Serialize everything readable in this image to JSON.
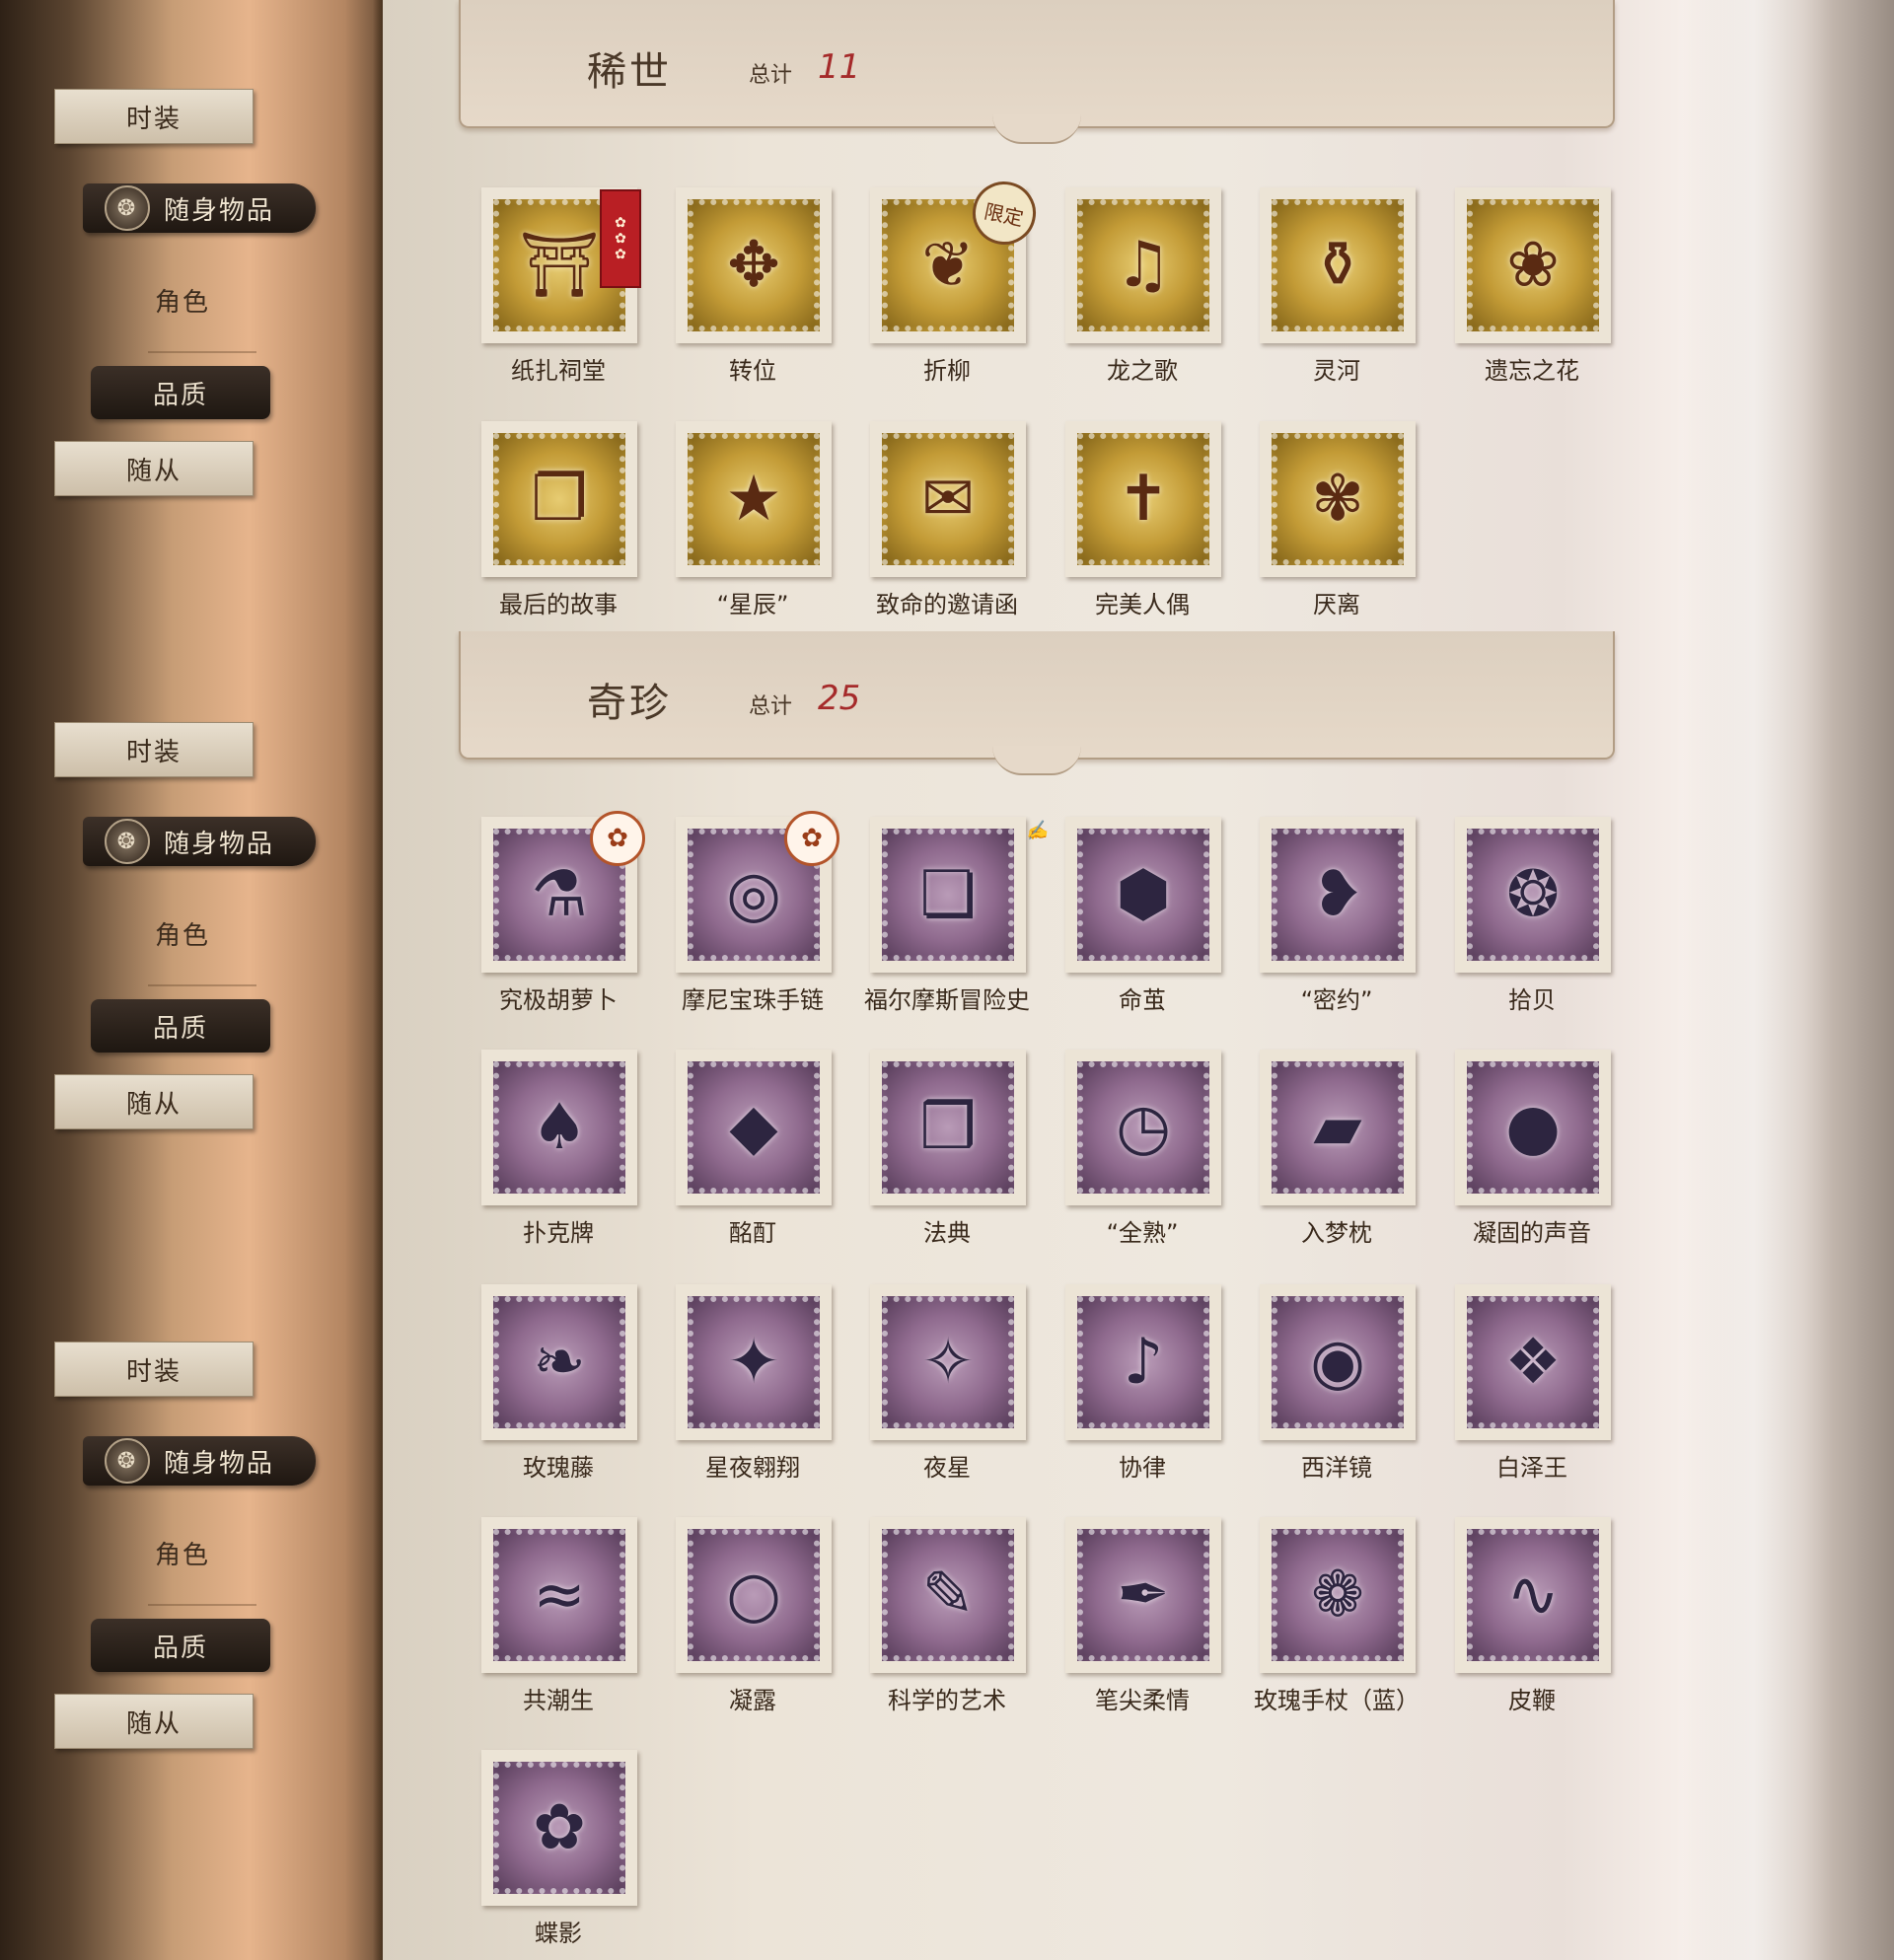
{
  "nav": {
    "fashion": "时装",
    "accessories": "随身物品",
    "role": "角色",
    "quality": "品质",
    "follower": "随从"
  },
  "sections": {
    "rare": {
      "title": "稀世",
      "total_label": "总计",
      "total": "11"
    },
    "precious": {
      "title": "奇珍",
      "total_label": "总计",
      "total": "25"
    }
  },
  "items": {
    "zhizha_citang": {
      "name": "纸扎祠堂",
      "icon": "paper-shrine-icon",
      "tier": "gold"
    },
    "zhuanwei": {
      "name": "转位",
      "icon": "transposition-icon",
      "tier": "gold"
    },
    "zheliu": {
      "name": "折柳",
      "icon": "willow-icon",
      "tier": "gold",
      "badge": "限定"
    },
    "longzhige": {
      "name": "龙之歌",
      "icon": "dragon-harp-icon",
      "tier": "gold"
    },
    "linghe": {
      "name": "灵河",
      "icon": "spirit-river-icon",
      "tier": "gold"
    },
    "yiwangzhihua": {
      "name": "遗忘之花",
      "icon": "forgotten-flower-icon",
      "tier": "gold"
    },
    "zuihoudegushi": {
      "name": "最后的故事",
      "icon": "last-story-book-icon",
      "tier": "gold"
    },
    "xingchen": {
      "name": "“星辰”",
      "icon": "star-bottle-icon",
      "tier": "gold"
    },
    "zhimingdeyaoqinghan": {
      "name": "致命的邀请函",
      "icon": "winged-letter-icon",
      "tier": "gold"
    },
    "wanmeirenou": {
      "name": "完美人偶",
      "icon": "ballerina-doll-icon",
      "tier": "gold"
    },
    "yanli": {
      "name": "厌离",
      "icon": "blossom-branch-icon",
      "tier": "gold"
    },
    "jiujihuluobo": {
      "name": "究极胡萝卜",
      "icon": "carrot-jar-icon",
      "tier": "purple"
    },
    "monibaozhushoulian": {
      "name": "摩尼宝珠手链",
      "icon": "bead-bracelet-icon",
      "tier": "purple"
    },
    "fuermosimaoxianshi": {
      "name": "福尔摩斯冒险史",
      "icon": "green-book-icon",
      "tier": "purple"
    },
    "mingjian": {
      "name": "命茧",
      "icon": "cocoon-icon",
      "tier": "purple"
    },
    "miyue": {
      "name": "“密约”",
      "icon": "necklace-icon",
      "tier": "purple"
    },
    "shibei": {
      "name": "拾贝",
      "icon": "seashell-icon",
      "tier": "purple"
    },
    "pukepai": {
      "name": "扑克牌",
      "icon": "poker-cards-icon",
      "tier": "purple"
    },
    "mingding": {
      "name": "酩酊",
      "icon": "blue-crystal-icon",
      "tier": "purple"
    },
    "fadian": {
      "name": "法典",
      "icon": "codex-icon",
      "tier": "purple"
    },
    "quanshu": {
      "name": "“全熟”",
      "icon": "pocket-watch-icon",
      "tier": "purple"
    },
    "rumengzhen": {
      "name": "入梦枕",
      "icon": "dream-pillow-icon",
      "tier": "purple"
    },
    "ningudeshengyin": {
      "name": "凝固的声音",
      "icon": "orb-icon",
      "tier": "purple"
    },
    "meiguiteng": {
      "name": "玫瑰藤",
      "icon": "rose-vine-icon",
      "tier": "purple"
    },
    "xingyeaoxiang": {
      "name": "星夜翱翔",
      "icon": "crystal-bird-icon",
      "tier": "purple"
    },
    "yexing": {
      "name": "夜星",
      "icon": "night-star-icon",
      "tier": "purple"
    },
    "xielv": {
      "name": "协律",
      "icon": "music-box-icon",
      "tier": "purple"
    },
    "xiyangjing": {
      "name": "西洋镜",
      "icon": "zoetrope-icon",
      "tier": "purple"
    },
    "baizewang": {
      "name": "白泽王",
      "icon": "white-deer-icon",
      "tier": "purple"
    },
    "gongchaosheng": {
      "name": "共潮生",
      "icon": "whale-icon",
      "tier": "purple"
    },
    "ninglu": {
      "name": "凝露",
      "icon": "dew-pearl-icon",
      "tier": "purple"
    },
    "kexuedeyishu": {
      "name": "科学的艺术",
      "icon": "science-book-icon",
      "tier": "purple"
    },
    "bijianrouqing": {
      "name": "笔尖柔情",
      "icon": "quill-icon",
      "tier": "purple"
    },
    "meiguishouzhang": {
      "name": "玫瑰手杖（蓝）",
      "icon": "rose-cane-icon",
      "tier": "purple"
    },
    "pibian": {
      "name": "皮鞭",
      "icon": "whip-icon",
      "tier": "purple"
    },
    "dieying": {
      "name": "蝶影",
      "icon": "butterfly-flower-icon",
      "tier": "purple"
    }
  },
  "colors": {
    "gold_stamp": "#c39b36",
    "purple_stamp": "#8f6a8e",
    "total_red": "#a52a2a",
    "nav_dark": "#1f1711"
  }
}
